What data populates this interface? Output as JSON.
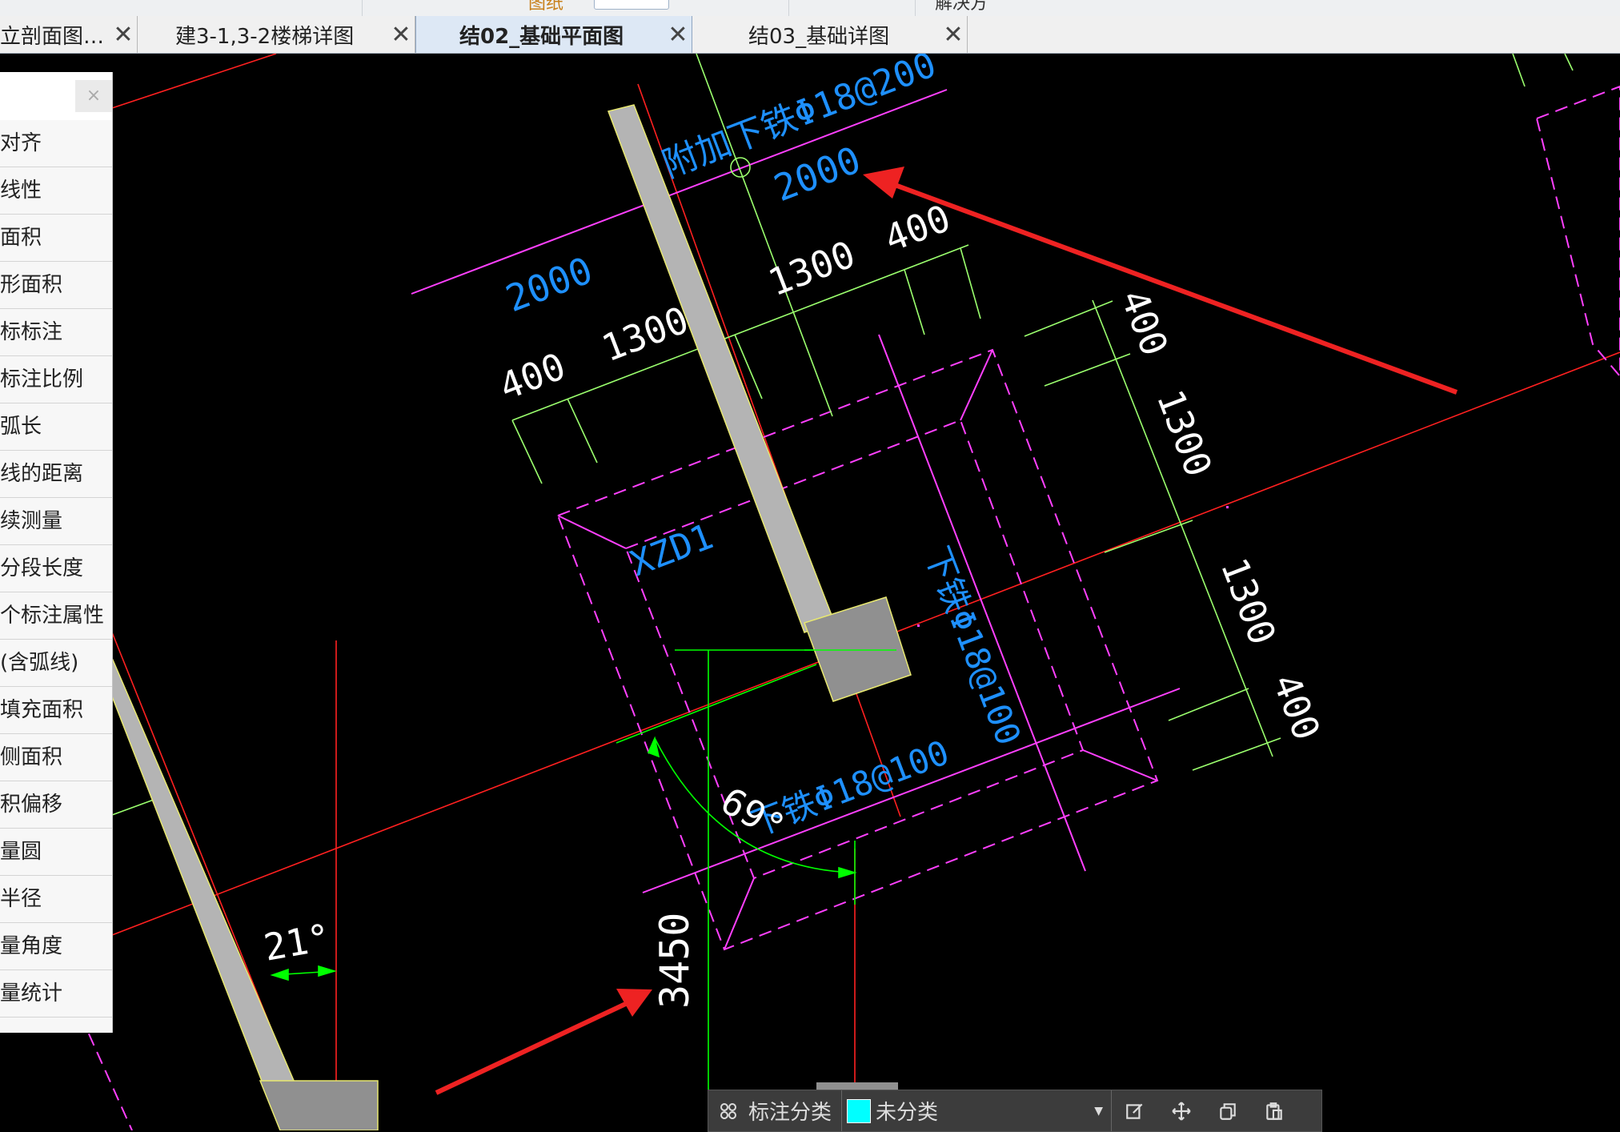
{
  "top_strip": {
    "left_text": "图纸",
    "right_text": "解决方"
  },
  "tabs": [
    {
      "label": "立剖面图…",
      "active": false
    },
    {
      "label": "建3-1,3-2楼梯详图",
      "active": false
    },
    {
      "label": "结02_基础平面图",
      "active": true
    },
    {
      "label": "结03_基础详图",
      "active": false
    }
  ],
  "tab_close_glyph": "✕",
  "panel": {
    "close_glyph": "×",
    "items": [
      "对齐",
      "线性",
      "面积",
      "形面积",
      "标标注",
      "标注比例",
      "弧长",
      "线的距离",
      "续测量",
      "分段长度",
      "个标注属性",
      "(含弧线)",
      "填充面积",
      "侧面积",
      "积偏移",
      "量圆",
      "半径",
      "量角度",
      "量统计"
    ]
  },
  "drawing": {
    "labels": {
      "extra_rebar": "附加下铁Φ18@200",
      "footing_id": "XZD1",
      "rebar_vertical": "下铁Φ18@100",
      "rebar_horizontal": "下铁Φ18@100",
      "angle_69": "69°",
      "angle_21": "21°",
      "dim_3450": "3450"
    },
    "dimensions": {
      "upper_row": [
        "400",
        "1300",
        "2000"
      ],
      "upper_right": [
        "2000",
        "1300",
        "400"
      ],
      "right_column": [
        "400",
        "1300",
        "1300",
        "400"
      ]
    },
    "colors": {
      "background": "#000000",
      "magenta": "#ff40ff",
      "green": "#9bff6e",
      "bright_green": "#00ff00",
      "red_axis": "#ff2020",
      "blue_text": "#1e90ff",
      "column_fill": "#b4b4b4",
      "footing_fill": "#909090",
      "arrow": "#ee2222"
    }
  },
  "bottom_bar": {
    "label": "标注分类",
    "category": "未分类",
    "swatch_color": "#00ffff",
    "icons": [
      "grid-icon",
      "edit-icon",
      "move-icon",
      "copy-icon",
      "paste-icon"
    ]
  }
}
